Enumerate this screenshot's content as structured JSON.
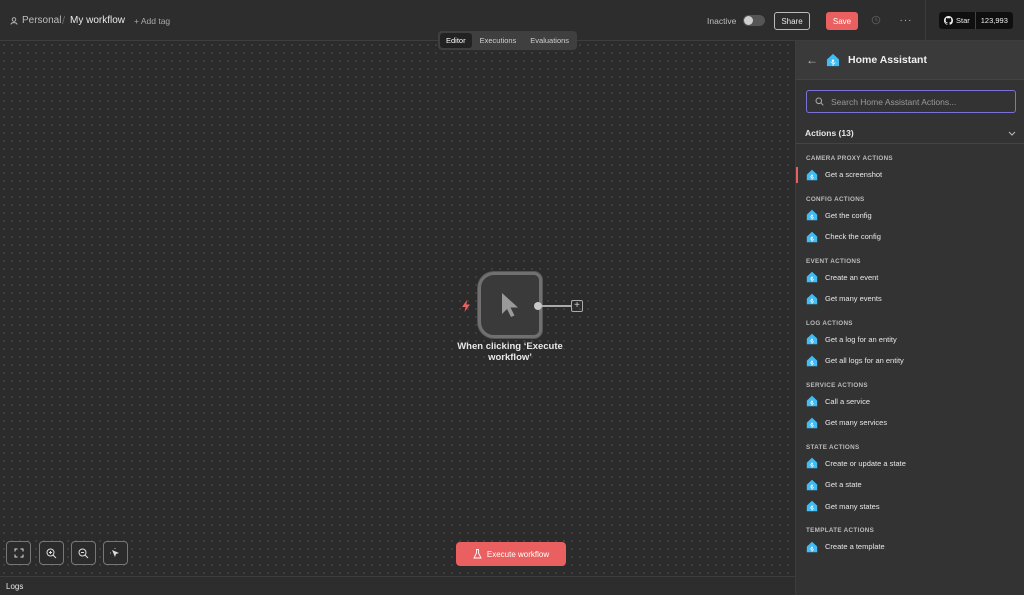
{
  "topbar": {
    "personal": "Personal",
    "workflow_title": "My workflow",
    "add_tag": "+ Add tag",
    "inactive_label": "Inactive",
    "share_label": "Share",
    "save_label": "Save",
    "more_label": "···",
    "github_star_label": "Star",
    "github_star_count": "123,993"
  },
  "tabs": [
    "Editor",
    "Executions",
    "Evaluations"
  ],
  "canvas": {
    "node_label": "When clicking ‘Execute workflow’",
    "execute_label": "Execute workflow"
  },
  "logs_label": "Logs",
  "panel": {
    "title": "Home Assistant",
    "search_placeholder": "Search Home Assistant Actions...",
    "actions_header": "Actions (13)",
    "sections": [
      {
        "label": "CAMERA PROXY ACTIONS",
        "items": [
          "Get a screenshot"
        ]
      },
      {
        "label": "CONFIG ACTIONS",
        "items": [
          "Get the config",
          "Check the config"
        ]
      },
      {
        "label": "EVENT ACTIONS",
        "items": [
          "Create an event",
          "Get many events"
        ]
      },
      {
        "label": "LOG ACTIONS",
        "items": [
          "Get a log for an entity",
          "Get all logs for an entity"
        ]
      },
      {
        "label": "SERVICE ACTIONS",
        "items": [
          "Call a service",
          "Get many services"
        ]
      },
      {
        "label": "STATE ACTIONS",
        "items": [
          "Create or update a state",
          "Get a state",
          "Get many states"
        ]
      },
      {
        "label": "TEMPLATE ACTIONS",
        "items": [
          "Create a template"
        ]
      }
    ]
  },
  "colors": {
    "accent": "#ea5f5f",
    "search_border": "#7b72d8",
    "home_assistant": "#41bdf5"
  }
}
